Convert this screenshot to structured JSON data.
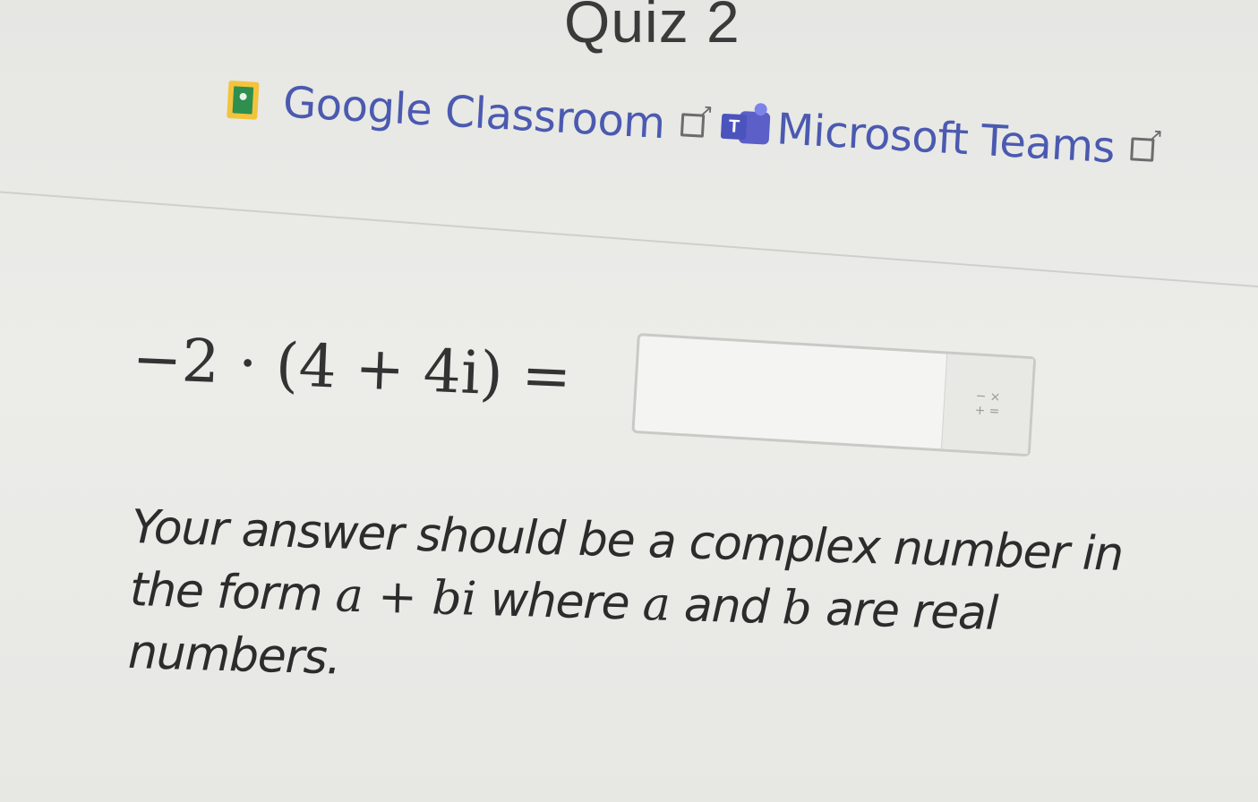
{
  "header": {
    "title": "Quiz 2"
  },
  "share": {
    "google_classroom_label": "Google Classroom",
    "microsoft_teams_label": "Microsoft Teams"
  },
  "question": {
    "expression": "−2 · (4 + 4i) =",
    "answer_value": "",
    "keypad_symbols": [
      "−",
      "×",
      "+",
      "="
    ],
    "instruction_part1": "Your answer should be a complex number in the form ",
    "instruction_math": "a + bi",
    "instruction_part2": " where ",
    "instruction_var_a": "a",
    "instruction_part3": " and ",
    "instruction_var_b": "b",
    "instruction_part4": " are real numbers."
  },
  "colors": {
    "link": "#4b5ab0",
    "background": "#e9e9e6",
    "google_classroom_green": "#2e8f4e",
    "google_classroom_yellow": "#f3c33c",
    "teams_purple": "#5b5fc7"
  },
  "icons": {
    "google_classroom": "google-classroom-icon",
    "teams": "microsoft-teams-icon",
    "external_link": "external-link-icon",
    "keypad": "math-keypad-icon"
  }
}
